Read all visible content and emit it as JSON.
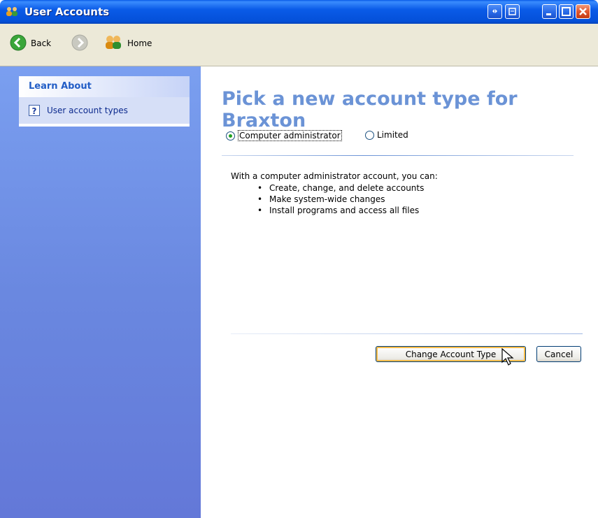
{
  "window": {
    "title": "User Accounts"
  },
  "toolbar": {
    "back_label": "Back",
    "home_label": "Home"
  },
  "sidebar": {
    "section_title": "Learn About",
    "items": [
      {
        "label": "User account types",
        "icon": "help-icon"
      }
    ]
  },
  "main": {
    "title": "Pick a new account type for Braxton",
    "options": [
      {
        "label": "Computer administrator",
        "selected": true
      },
      {
        "label": "Limited",
        "selected": false
      }
    ],
    "description": "With a computer administrator account, you can:",
    "bullets": [
      "Create, change, and delete accounts",
      "Make system-wide changes",
      "Install programs and access all files"
    ],
    "primary_button": "Change Account Type",
    "cancel_button": "Cancel"
  },
  "colors": {
    "titlebar": "#0a5ce8",
    "sidebar": "#6a88e0",
    "heading": "#6b93d6",
    "link": "#0c2a8e"
  }
}
